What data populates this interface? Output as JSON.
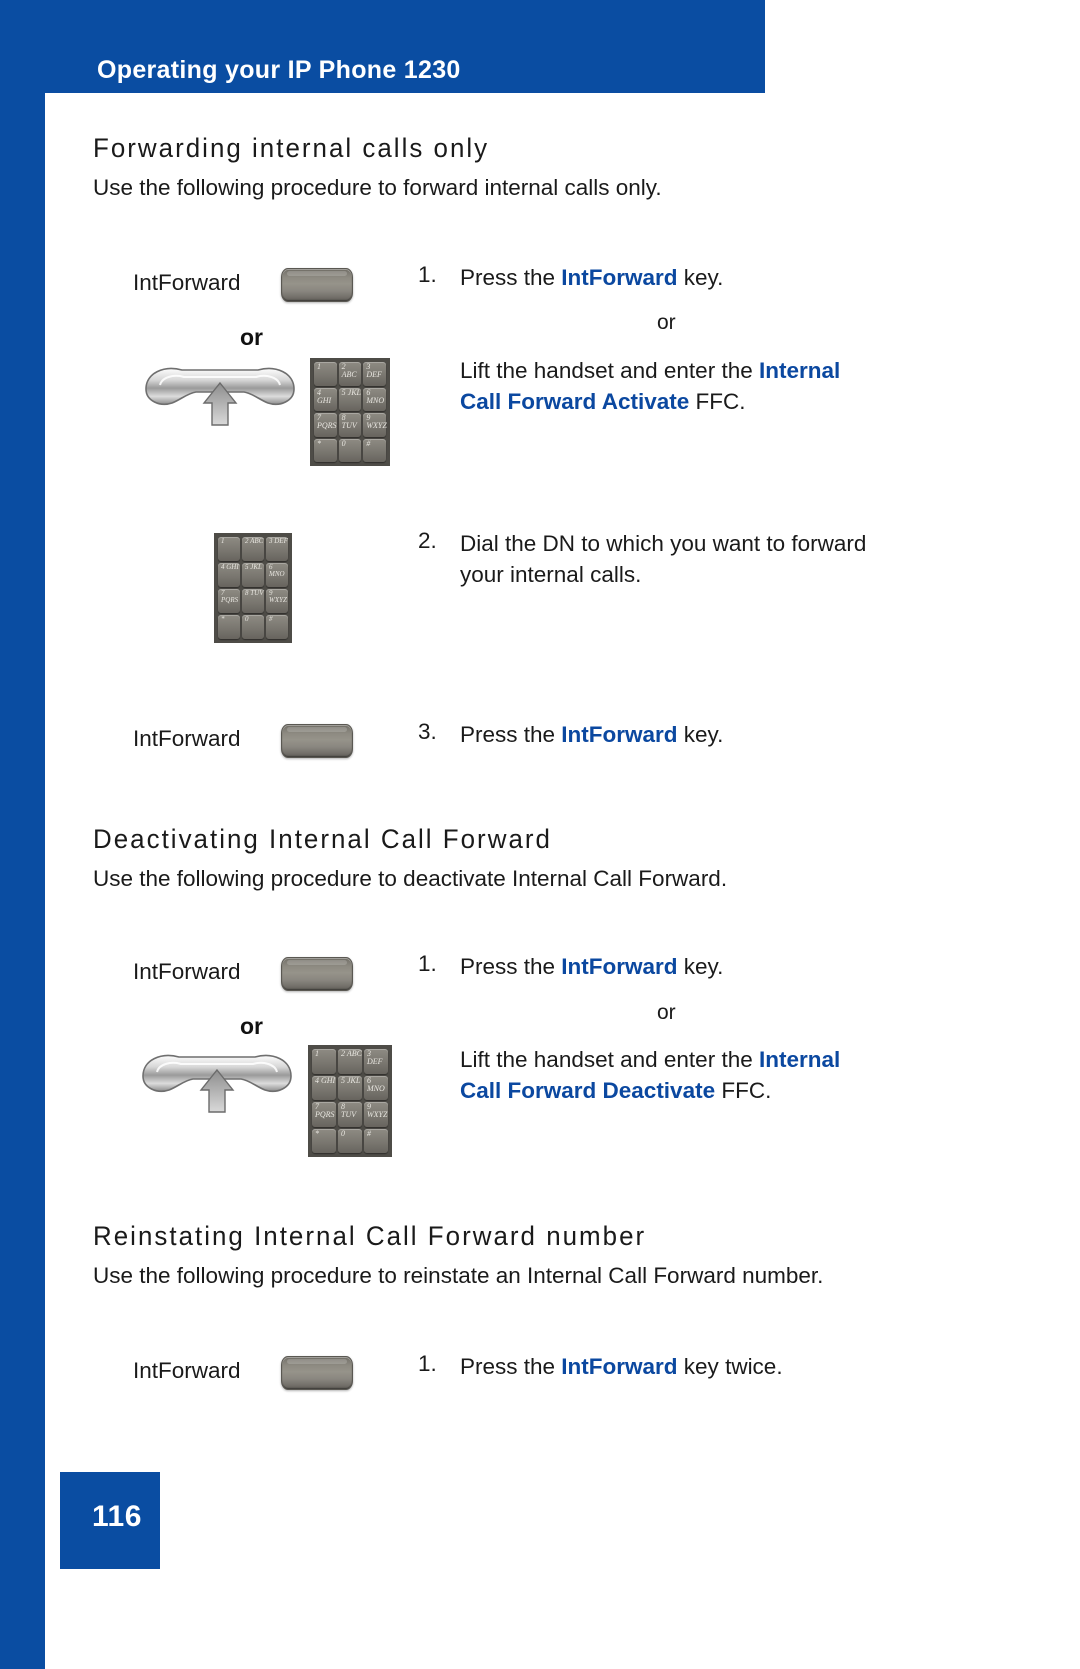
{
  "page": {
    "header_title": "Operating your IP Phone 1230",
    "page_number": "116",
    "accent_color": "#0a4da2",
    "highlight_color": "#0b48a0"
  },
  "sections": [
    {
      "heading": "Forwarding internal calls only",
      "intro": "Use the following procedure to forward internal calls only.",
      "steps": [
        {
          "number": "1.",
          "text_prefix": "Press the ",
          "text_highlight": "IntForward",
          "text_suffix": " key.",
          "or_label": "or",
          "alt_prefix": "Lift the handset and enter the ",
          "alt_highlight_line1": "Internal",
          "alt_highlight_line2": "Call Forward Activate",
          "alt_suffix": " FFC.",
          "key_label": "IntForward",
          "left_or_label": "or"
        },
        {
          "number": "2.",
          "text_line1": "Dial the DN to which you want to forward",
          "text_line2": "your internal calls."
        },
        {
          "number": "3.",
          "text_prefix": "Press the ",
          "text_highlight": "IntForward",
          "text_suffix": " key.",
          "key_label": "IntForward"
        }
      ]
    },
    {
      "heading": "Deactivating Internal Call Forward",
      "intro": "Use the following procedure to deactivate Internal Call Forward.",
      "steps": [
        {
          "number": "1.",
          "text_prefix": "Press the ",
          "text_highlight": "IntForward",
          "text_suffix": " key.",
          "or_label": "or",
          "alt_prefix": "Lift the handset and enter the ",
          "alt_highlight_line1": "Internal",
          "alt_highlight_line2": "Call Forward Deactivate",
          "alt_suffix": " FFC.",
          "key_label": "IntForward",
          "left_or_label": "or"
        }
      ]
    },
    {
      "heading": "Reinstating Internal Call Forward number",
      "intro": "Use the following procedure to reinstate an Internal Call Forward number.",
      "steps": [
        {
          "number": "1.",
          "text_prefix": "Press the ",
          "text_highlight": "IntForward",
          "text_suffix": " key twice.",
          "key_label": "IntForward"
        }
      ]
    }
  ],
  "keypad_keys": [
    "1",
    "2 ABC",
    "3 DEF",
    "4 GHI",
    "5 JKL",
    "6 MNO",
    "7 PQRS",
    "8 TUV",
    "9 WXYZ",
    "*",
    "0",
    "#"
  ]
}
